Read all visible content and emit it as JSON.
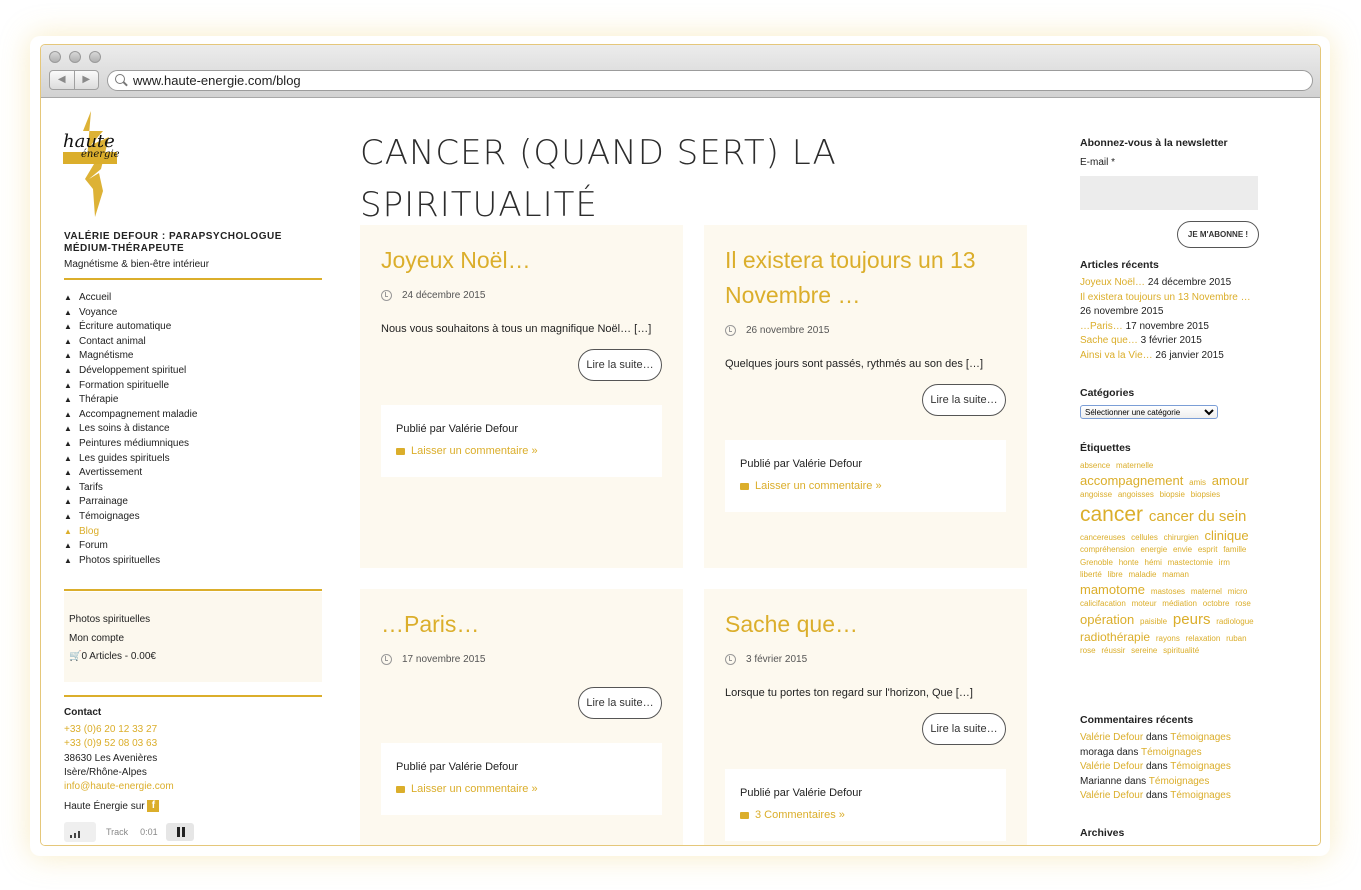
{
  "browser": {
    "url": "www.haute-energie.com/blog"
  },
  "logo": {
    "line1": "haute",
    "line2": "énergie"
  },
  "site": {
    "title": "VALÉRIE DEFOUR : PARAPSYCHOLOGUE MÉDIUM-THÉRAPEUTE",
    "tagline": "Magnétisme & bien-être intérieur"
  },
  "menu": [
    "Accueil",
    "Voyance",
    "Écriture automatique",
    "Contact animal",
    "Magnétisme",
    "Développement spirituel",
    "Formation spirituelle",
    "Thérapie",
    "Accompagnement maladie",
    "Les soins à distance",
    "Peintures médiumniques",
    "Les guides spirituels",
    "Avertissement",
    "Tarifs",
    "Parrainage",
    "Témoignages",
    "Blog",
    "Forum",
    "Photos spirituelles"
  ],
  "menu_active": "Blog",
  "userbox": {
    "photos": "Photos spirituelles",
    "account": "Mon compte",
    "cart": "0 Articles - 0.00€"
  },
  "contact": {
    "heading": "Contact",
    "phone1": "+33 (0)6 20 12 33 27",
    "phone2": "+33 (0)9 52 08 03 63",
    "address1": "38630 Les Avenières",
    "address2": "Isère/Rhône-Alpes",
    "email": "info@haute-energie.com",
    "social": "Haute Énergie sur"
  },
  "player": {
    "track": "Track",
    "time": "0:01"
  },
  "page_title": "CANCER (QUAND SERT) LA SPIRITUALITÉ",
  "posts": [
    {
      "title": "Joyeux Noël…",
      "date": "24 décembre 2015",
      "excerpt": "Nous vous souhaitons à tous un magnifique Noël… […]",
      "more": "Lire la suite…",
      "author": "Publié par Valérie Defour",
      "comments": "Laisser un commentaire »"
    },
    {
      "title": "Il existera toujours un 13 Novembre …",
      "date": "26 novembre 2015",
      "excerpt": "Quelques jours sont passés, rythmés au son des […]",
      "more": "Lire la suite…",
      "author": "Publié par Valérie Defour",
      "comments": "Laisser un commentaire »"
    },
    {
      "title": "…Paris…",
      "date": "17 novembre 2015",
      "excerpt": "",
      "more": "Lire la suite…",
      "author": "Publié par Valérie Defour",
      "comments": "Laisser un commentaire »"
    },
    {
      "title": "Sache que…",
      "date": "3 février 2015",
      "excerpt": "Lorsque tu portes ton regard sur l'horizon, Que […]",
      "more": "Lire la suite…",
      "author": "Publié par Valérie Defour",
      "comments": "3 Commentaires »"
    }
  ],
  "newsletter": {
    "heading": "Abonnez-vous à la newsletter",
    "label": "E-mail *",
    "button": "JE M'ABONNE !"
  },
  "recent_posts": {
    "heading": "Articles récents",
    "items": [
      {
        "title": "Joyeux Noël…",
        "date": "24 décembre 2015"
      },
      {
        "title": "Il existera toujours un 13 Novembre …",
        "date": ""
      },
      {
        "title": "",
        "date": "26 novembre 2015"
      },
      {
        "title": "…Paris…",
        "date": "17 novembre 2015"
      },
      {
        "title": "Sache que…",
        "date": "3 février 2015"
      },
      {
        "title": "Ainsi va la Vie…",
        "date": "26 janvier 2015"
      }
    ]
  },
  "categories": {
    "heading": "Catégories",
    "select": "Sélectionner une catégorie"
  },
  "tags": {
    "heading": "Étiquettes",
    "items": [
      {
        "t": "absence",
        "s": 8
      },
      {
        "t": "maternelle",
        "s": 8
      },
      {
        "t": "accompagnement",
        "s": 13
      },
      {
        "t": "amis",
        "s": 8
      },
      {
        "t": "amour",
        "s": 13
      },
      {
        "t": "angoisse",
        "s": 8
      },
      {
        "t": "angoisses",
        "s": 8
      },
      {
        "t": "biopsie",
        "s": 8
      },
      {
        "t": "biopsies",
        "s": 8
      },
      {
        "t": "cancer",
        "s": 21
      },
      {
        "t": "cancer du sein",
        "s": 15
      },
      {
        "t": "cancereuses",
        "s": 8
      },
      {
        "t": "cellules",
        "s": 8
      },
      {
        "t": "chirurgien",
        "s": 8
      },
      {
        "t": "clinique",
        "s": 13
      },
      {
        "t": "compréhension",
        "s": 8
      },
      {
        "t": "energie",
        "s": 8
      },
      {
        "t": "envie",
        "s": 8
      },
      {
        "t": "esprit",
        "s": 8
      },
      {
        "t": "famille",
        "s": 8
      },
      {
        "t": "Grenoble",
        "s": 8
      },
      {
        "t": "honte",
        "s": 8
      },
      {
        "t": "hémi",
        "s": 8
      },
      {
        "t": "mastectomie",
        "s": 8
      },
      {
        "t": "irm",
        "s": 8
      },
      {
        "t": "liberté",
        "s": 8
      },
      {
        "t": "libre",
        "s": 8
      },
      {
        "t": "maladie",
        "s": 8
      },
      {
        "t": "maman",
        "s": 8
      },
      {
        "t": "mamotome",
        "s": 13
      },
      {
        "t": "mastoses",
        "s": 8
      },
      {
        "t": "maternel",
        "s": 8
      },
      {
        "t": "micro",
        "s": 8
      },
      {
        "t": "calicifacation",
        "s": 8
      },
      {
        "t": "moteur",
        "s": 8
      },
      {
        "t": "médiation",
        "s": 8
      },
      {
        "t": "octobre",
        "s": 8
      },
      {
        "t": "rose",
        "s": 8
      },
      {
        "t": "opération",
        "s": 13
      },
      {
        "t": "paisible",
        "s": 8
      },
      {
        "t": "peurs",
        "s": 15
      },
      {
        "t": "radiologue",
        "s": 8
      },
      {
        "t": "radiothérapie",
        "s": 12
      },
      {
        "t": "rayons",
        "s": 8
      },
      {
        "t": "relaxation",
        "s": 8
      },
      {
        "t": "ruban",
        "s": 8
      },
      {
        "t": "rose",
        "s": 8
      },
      {
        "t": "réussir",
        "s": 8
      },
      {
        "t": "sereine",
        "s": 8
      },
      {
        "t": "spiritualité",
        "s": 8
      }
    ]
  },
  "recent_comments": {
    "heading": "Commentaires récents",
    "items": [
      {
        "author": "Valérie Defour",
        "author_link": true,
        "in": "dans",
        "post": "Témoignages"
      },
      {
        "author": "moraga",
        "author_link": false,
        "in": "dans",
        "post": "Témoignages"
      },
      {
        "author": "Valérie Defour",
        "author_link": true,
        "in": "dans",
        "post": "Témoignages"
      },
      {
        "author": "Marianne",
        "author_link": false,
        "in": "dans",
        "post": "Témoignages"
      },
      {
        "author": "Valérie Defour",
        "author_link": true,
        "in": "dans",
        "post": "Témoignages"
      }
    ]
  },
  "archives": {
    "heading": "Archives"
  },
  "colors": {
    "accent": "#dbae2b",
    "card_bg": "#fdf9ef"
  }
}
